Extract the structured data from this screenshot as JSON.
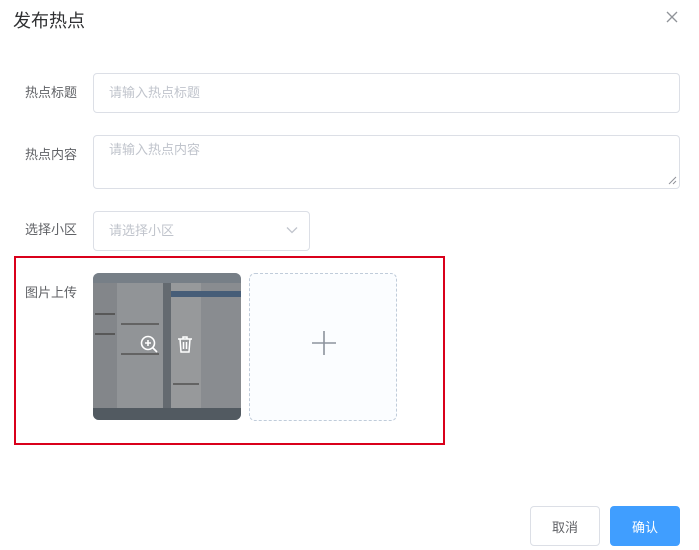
{
  "dialog": {
    "title": "发布热点",
    "close_icon": "close-icon"
  },
  "form": {
    "title_field": {
      "label": "热点标题",
      "placeholder": "请输入热点标题",
      "value": ""
    },
    "content_field": {
      "label": "热点内容",
      "placeholder": "请输入热点内容",
      "value": ""
    },
    "community_select": {
      "label": "选择小区",
      "placeholder": "请选择小区",
      "icon": "chevron-down-icon"
    },
    "image_upload": {
      "label": "图片上传",
      "preview_icon": "zoom-in-icon",
      "delete_icon": "trash-icon",
      "add_icon": "plus-icon",
      "highlight_color": "#d9001b"
    }
  },
  "footer": {
    "cancel_label": "取消",
    "confirm_label": "确认"
  },
  "colors": {
    "primary": "#409eff",
    "border": "#dcdfe6",
    "placeholder": "#c0c4cc"
  }
}
